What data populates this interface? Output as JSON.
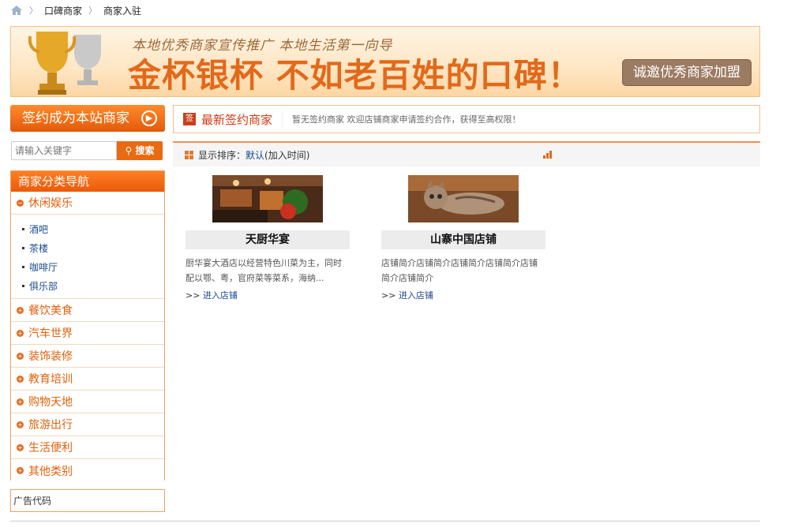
{
  "breadcrumb": {
    "items": [
      "口碑商家",
      "商家入驻"
    ]
  },
  "banner": {
    "subtitle": "本地优秀商家宣传推广 本地生活第一向导",
    "title": "金杯银杯 不如老百姓的口碑！",
    "join_button": "诚邀优秀商家加盟"
  },
  "sidebar": {
    "sign_button": "签约成为本站商家",
    "search_placeholder": "请输入关键字",
    "search_button": "搜索",
    "nav_title": "商家分类导航",
    "open_category": "休闲娱乐",
    "sub_items": [
      "酒吧",
      "茶楼",
      "咖啡厅",
      "俱乐部"
    ],
    "categories": [
      "餐饮美食",
      "汽车世界",
      "装饰装修",
      "教育培训",
      "购物天地",
      "旅游出行",
      "生活便利",
      "其他类别"
    ],
    "ad_label": "广告代码"
  },
  "newest": {
    "icon_glyph": "签",
    "title": "最新签约商家",
    "note": "暂无签约商家 欢迎店铺商家申请签约合作，获得至高权限！"
  },
  "sortbar": {
    "label": "显示排序：",
    "default_link": "默认",
    "suffix": "(加入时间)"
  },
  "shops": [
    {
      "name": "天厨华宴",
      "desc": "厨华宴大酒店以经营特色川菜为主，同时配以鄂、粤，官府菜等菜系，海纳...",
      "link_prefix": ">> ",
      "link": "进入店铺"
    },
    {
      "name": "山寨中国店铺",
      "desc": "店铺简介店铺简介店铺简介店铺简介店铺简介店铺简介",
      "link_prefix": ">> ",
      "link": "进入店铺"
    }
  ],
  "colors": {
    "accent": "#e86a12",
    "link": "#1a4a8c"
  }
}
